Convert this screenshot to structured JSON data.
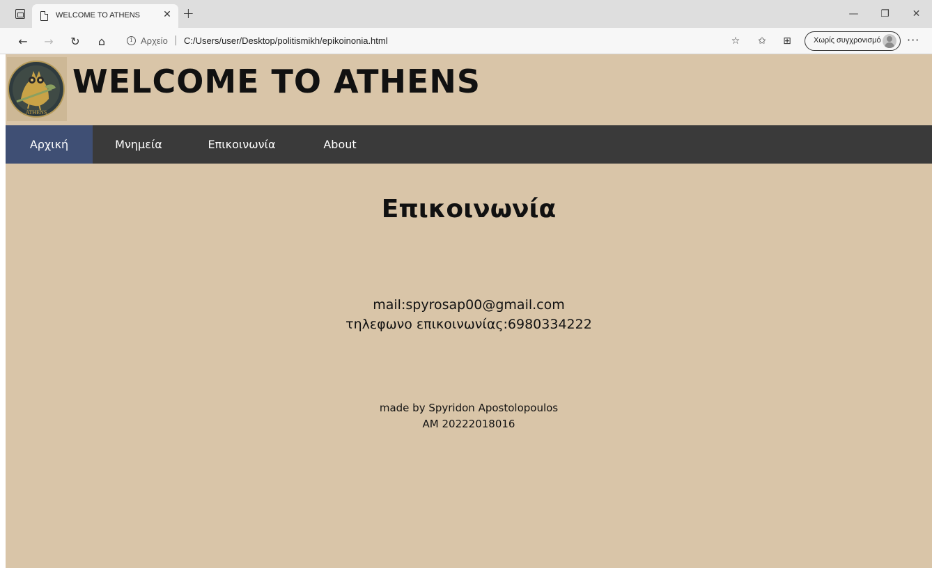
{
  "browser": {
    "tab_title": "WELCOME TO ATHENS",
    "url_scheme": "Αρχείο",
    "url_separator": "|",
    "url": "C:/Users/user/Desktop/politismikh/epikoinonia.html",
    "sync_label": "Χωρίς συγχρονισμό",
    "icons": {
      "tab_actions": "tab-actions-icon",
      "page": "page-icon",
      "close": "close-icon",
      "new_tab": "plus-icon",
      "back": "arrow-left-icon",
      "forward": "arrow-right-icon",
      "refresh": "refresh-icon",
      "home": "home-icon",
      "info": "info-icon",
      "favorite": "star-plus-icon",
      "favorites": "favorites-list-icon",
      "collections": "collections-icon",
      "more": "ellipsis-icon"
    }
  },
  "site": {
    "title": "WELCOME TO ATHENS",
    "logo_text": "ATHENS",
    "nav": [
      {
        "label": "Αρχική",
        "active": true
      },
      {
        "label": "Μνημεία",
        "active": false
      },
      {
        "label": "Επικοινωνία",
        "active": false
      },
      {
        "label": "About",
        "active": false
      }
    ],
    "heading": "Επικοινωνία",
    "contact": {
      "mail": "mail:spyrosap00@gmail.com",
      "phone": "τηλεφωνο επικοινωνίας:6980334222"
    },
    "footer": {
      "made_by": "made by Spyridon Apostolopoulos",
      "am": "AM 20222018016"
    }
  },
  "colors": {
    "page_background": "#d9c5a8",
    "navbar": "#3a3a3a",
    "nav_active": "#3f4f74",
    "text": "#111111"
  }
}
